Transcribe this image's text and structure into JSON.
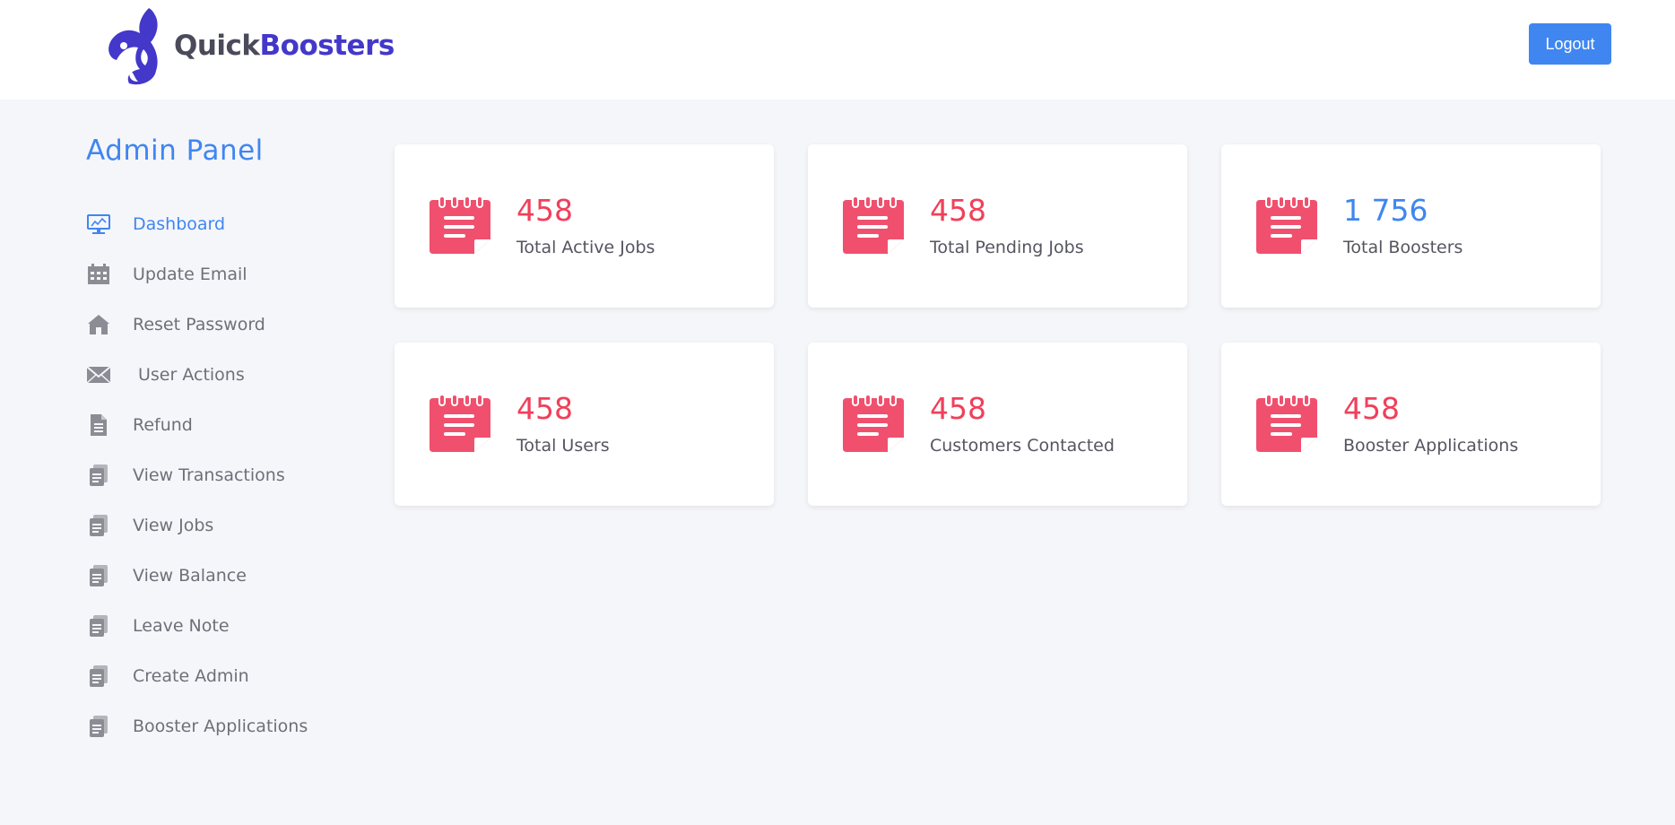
{
  "brand": {
    "part1": "Quick",
    "part2": "Boosters"
  },
  "header": {
    "logout_label": "Logout"
  },
  "sidebar": {
    "title": "Admin Panel",
    "items": [
      {
        "label": "Dashboard",
        "icon": "monitor-chart-icon"
      },
      {
        "label": "Update Email",
        "icon": "calendar-icon"
      },
      {
        "label": "Reset Password",
        "icon": "home-icon"
      },
      {
        "label": "User Actions",
        "icon": "envelope-icon"
      },
      {
        "label": "Refund",
        "icon": "file-icon"
      },
      {
        "label": "View Transactions",
        "icon": "documents-icon"
      },
      {
        "label": "View Jobs",
        "icon": "documents-icon"
      },
      {
        "label": "View Balance",
        "icon": "documents-icon"
      },
      {
        "label": "Leave Note",
        "icon": "documents-icon"
      },
      {
        "label": "Create Admin",
        "icon": "documents-icon"
      },
      {
        "label": "Booster Applications",
        "icon": "documents-icon"
      }
    ]
  },
  "cards": [
    {
      "value": "458",
      "label": "Total Active Jobs",
      "icon": "notepad-icon"
    },
    {
      "value": "458",
      "label": "Total Pending Jobs",
      "icon": "notepad-icon"
    },
    {
      "value": "1 756",
      "label": "Total Boosters",
      "icon": "notepad-icon"
    },
    {
      "value": "458",
      "label": "Total Users",
      "icon": "notepad-icon"
    },
    {
      "value": "458",
      "label": "Customers Contacted",
      "icon": "notepad-icon"
    },
    {
      "value": "458",
      "label": "Booster Applications",
      "icon": "notepad-icon"
    }
  ],
  "colors": {
    "accent": "#3f86f0",
    "stat_red": "#f0405a",
    "card_icon": "#f0506e",
    "brand_purple": "#4338ca",
    "menu_gray": "#6f6f78"
  }
}
